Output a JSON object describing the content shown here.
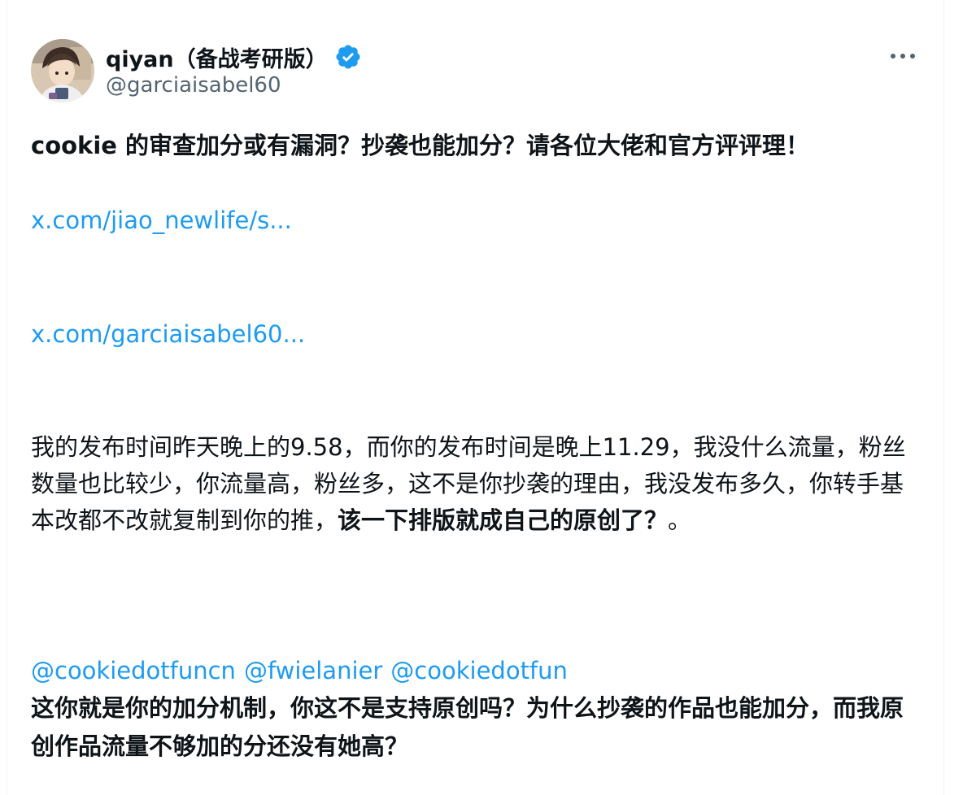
{
  "author": {
    "display_name": "qiyan（备战考研版）",
    "handle": "@garciaisabel60"
  },
  "post": {
    "headline": "cookie 的审查加分或有漏洞？抄袭也能加分？请各位大佬和官方评评理！",
    "link1": "x.com/jiao_newlife/s...",
    "link2": "x.com/garciaisabel60...",
    "body_regular": "我的发布时间昨天晚上的9.58，而你的发布时间是晚上11.29，我没什么流量，粉丝数量也比较少，你流量高，粉丝多，这不是你抄袭的理由，我没发布多久，你转手基本改都不改就复制到你的推，",
    "body_bold": "该一下排版就成自己的原创了？",
    "body_end": "。",
    "mentions": [
      "@cookiedotfuncn",
      "@fwielanier",
      "@cookiedotfun"
    ],
    "closing": "这你就是你的加分机制，你这不是支持原创吗？为什么抄袭的作品也能加分，而我原创作品流量不够加的分还没有她高？"
  },
  "icons": {
    "verified": "verified-badge-icon",
    "more": "more-options-icon"
  },
  "colors": {
    "link": "#1d9bf0",
    "text": "#0f1419",
    "secondary": "#536471"
  }
}
